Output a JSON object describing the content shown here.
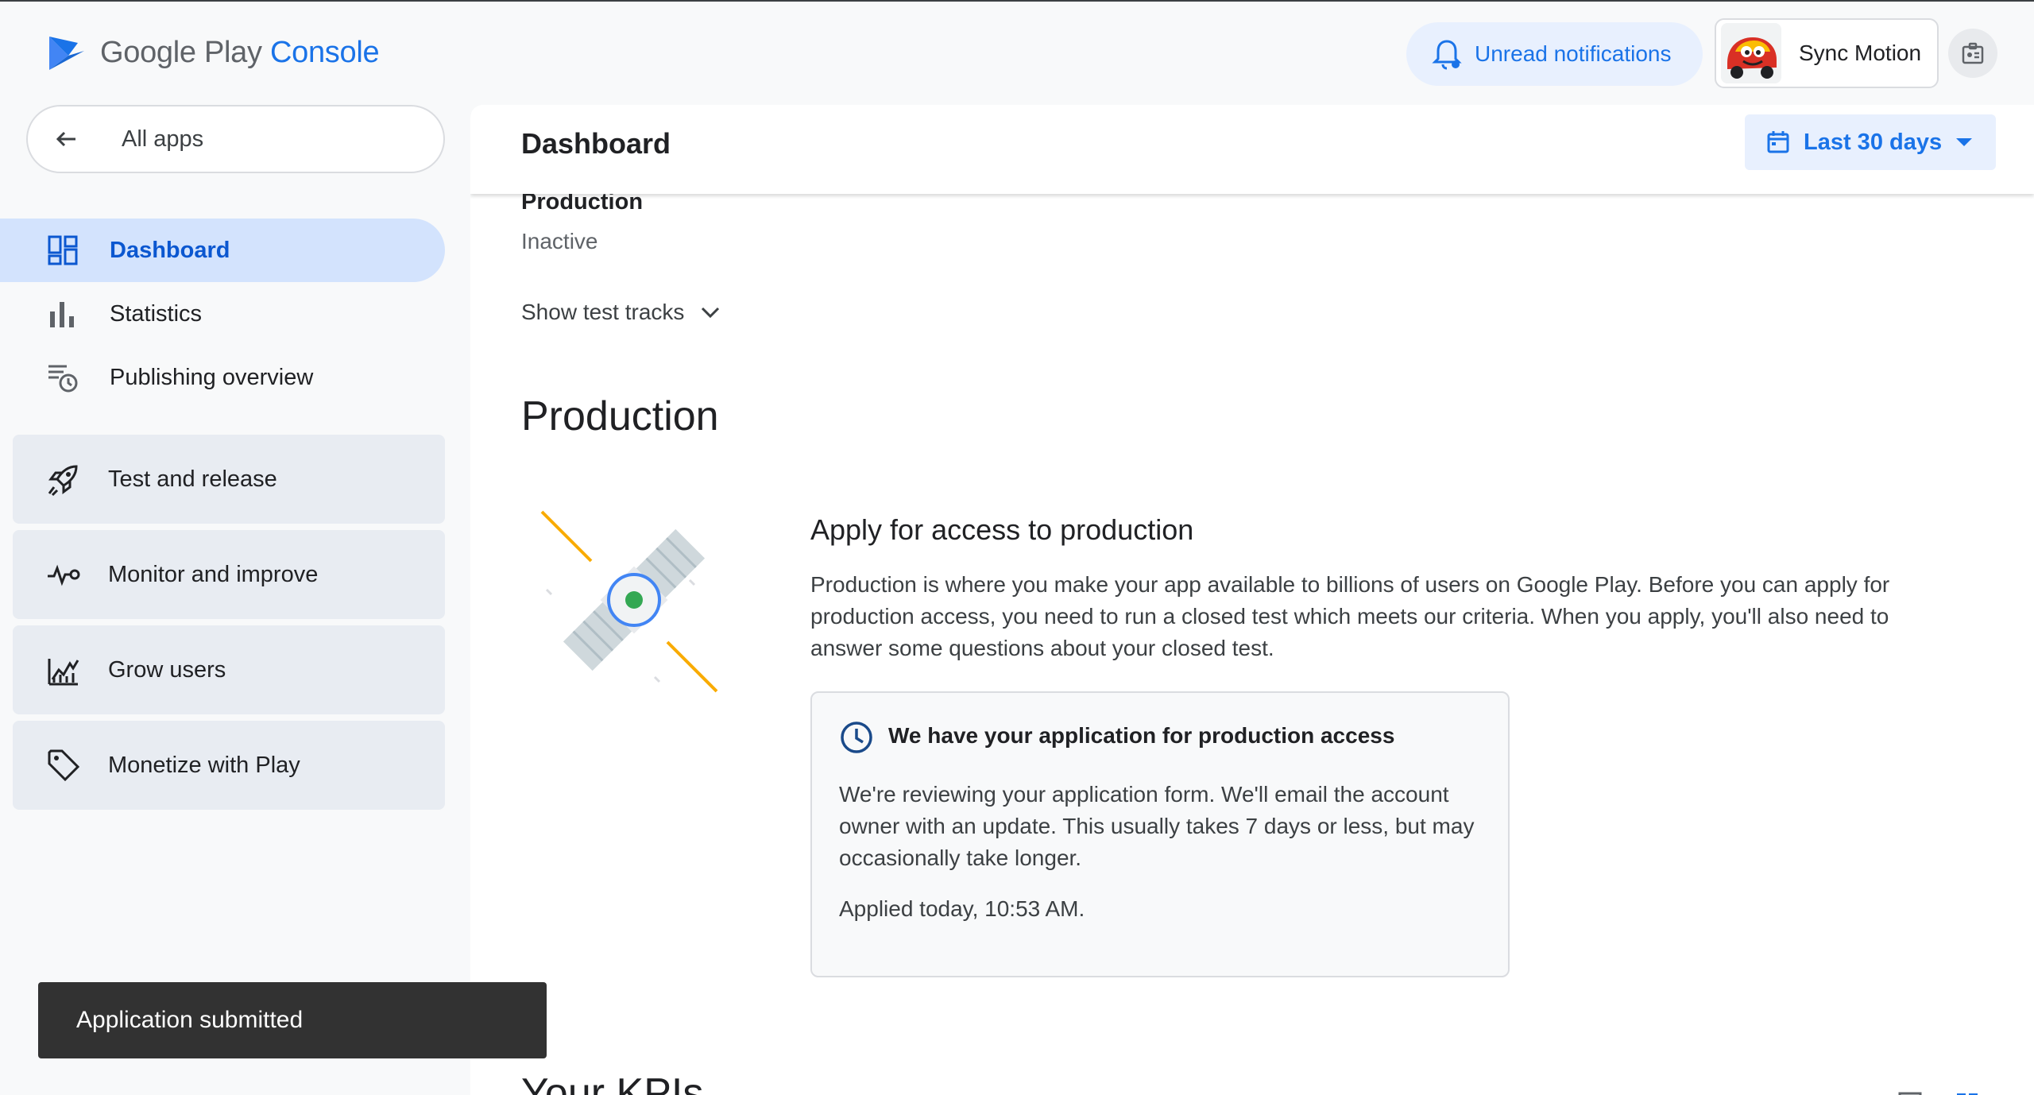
{
  "brand": {
    "name_prefix": "Google Play",
    "name_suffix": "Console"
  },
  "topbar": {
    "notifications_label": "Unread notifications",
    "account_name": "Sync Motion"
  },
  "sidebar": {
    "back_label": "All apps",
    "items": [
      {
        "label": "Dashboard",
        "icon": "dashboard-icon",
        "active": true
      },
      {
        "label": "Statistics",
        "icon": "bar-chart-icon",
        "active": false
      },
      {
        "label": "Publishing overview",
        "icon": "schedule-list-icon",
        "active": false
      }
    ],
    "groups": [
      {
        "label": "Test and release",
        "icon": "rocket-icon"
      },
      {
        "label": "Monitor and improve",
        "icon": "pulse-icon"
      },
      {
        "label": "Grow users",
        "icon": "growth-icon"
      },
      {
        "label": "Monetize with Play",
        "icon": "tag-icon"
      }
    ]
  },
  "main": {
    "title": "Dashboard",
    "date_range": "Last 30 days",
    "track": {
      "name": "Production",
      "status": "Inactive"
    },
    "show_test_tracks": "Show test tracks",
    "section_title": "Production",
    "apply": {
      "title": "Apply for access to production",
      "description": "Production is where you make your app available to billions of users on Google Play. Before you can apply for production access, you need to run a closed test which meets our criteria. When you apply, you'll also need to answer some questions about your closed test."
    },
    "status_card": {
      "heading": "We have your application for production access",
      "body": "We're reviewing your application form. We'll email the account owner with an update. This usually takes 7 days or less, but may occasionally take longer.",
      "applied": "Applied today, 10:53 AM."
    },
    "kpi_title": "Your KPIs"
  },
  "snackbar": {
    "message": "Application submitted"
  },
  "colors": {
    "accent": "#1a73e8",
    "active_nav_bg": "#d3e3fd",
    "group_bg": "#e8ecf2",
    "snackbar_bg": "#323232"
  }
}
